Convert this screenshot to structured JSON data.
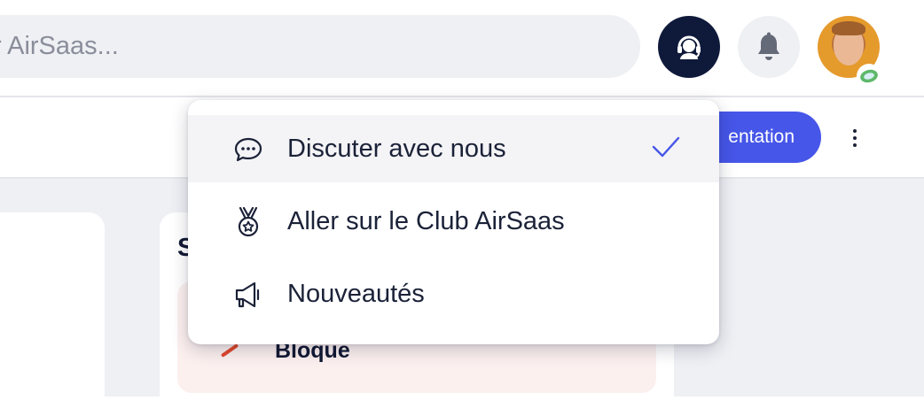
{
  "header": {
    "search_placeholder": "r AirSaas...",
    "support_icon": "headset-icon",
    "bell_icon": "bell-icon",
    "avatar_icon": "user-avatar",
    "avatar_badge_icon": "status-badge-icon"
  },
  "toolbar": {
    "primary_button_label": "entation",
    "more_icon": "kebab-menu-icon"
  },
  "content": {
    "card_title": "S",
    "status_label": "Bloque"
  },
  "menu": {
    "items": [
      {
        "label": "Discuter avec nous",
        "icon": "chat-bubble-icon",
        "selected": true
      },
      {
        "label": "Aller sur le Club AirSaas",
        "icon": "medal-icon",
        "selected": false
      },
      {
        "label": "Nouveautés",
        "icon": "megaphone-icon",
        "selected": false
      }
    ]
  },
  "colors": {
    "accent": "#4656e8",
    "dark": "#0f1a3b",
    "check": "#4656e8",
    "blocked_bg": "#fcf0ef"
  }
}
